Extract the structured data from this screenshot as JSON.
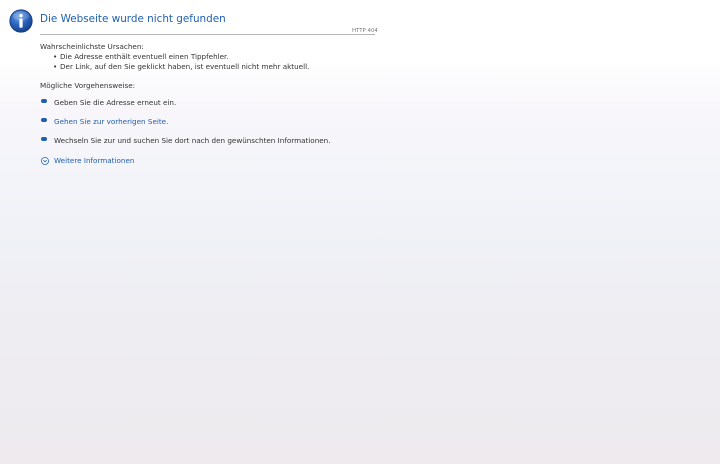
{
  "header": {
    "title": "Die Webseite wurde nicht gefunden",
    "http_code": "HTTP 404",
    "icon": "info-icon"
  },
  "causes": {
    "label": "Wahrscheinlichste Ursachen:",
    "items": [
      "Die Adresse enthält eventuell einen Tippfehler.",
      "Der Link, auf den Sie geklickt haben, ist eventuell nicht mehr aktuell."
    ]
  },
  "actions": {
    "label": "Mögliche Vorgehensweise:",
    "items": [
      {
        "text": "Geben Sie die Adresse erneut ein.",
        "is_link": false
      },
      {
        "text": "Gehen Sie zur vorherigen Seite.",
        "is_link": true
      },
      {
        "text": "Wechseln Sie zur  und suchen Sie dort nach den gewünschten Informationen.",
        "is_link": false
      }
    ]
  },
  "more_info": {
    "label": "Weitere Informationen",
    "icon": "chevron-down-circle-icon"
  },
  "colors": {
    "accent": "#1f5fae",
    "text": "#333333",
    "rule": "#b5b5b5"
  }
}
